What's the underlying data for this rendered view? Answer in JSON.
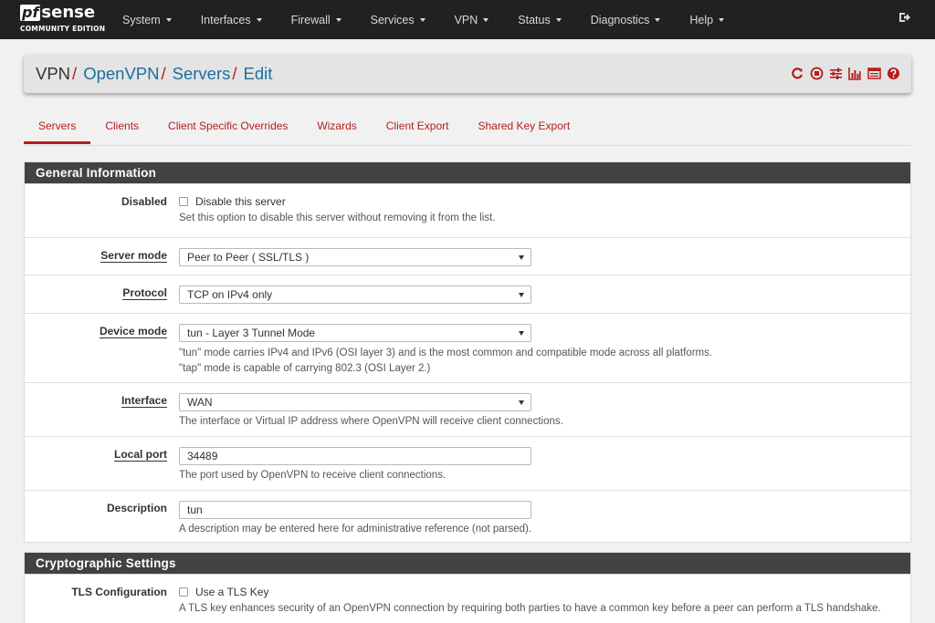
{
  "brand": {
    "logo_pf": "pf",
    "logo_sense": "sense",
    "logo_sub": "COMMUNITY EDITION"
  },
  "nav": {
    "items": [
      {
        "label": "System"
      },
      {
        "label": "Interfaces"
      },
      {
        "label": "Firewall"
      },
      {
        "label": "Services"
      },
      {
        "label": "VPN"
      },
      {
        "label": "Status"
      },
      {
        "label": "Diagnostics"
      },
      {
        "label": "Help"
      }
    ],
    "logout_icon": "logout-icon"
  },
  "breadcrumb": {
    "vpn": "VPN",
    "openvpn": "OpenVPN",
    "servers": "Servers",
    "edit": "Edit",
    "sep": "/"
  },
  "tabs": [
    {
      "label": "Servers",
      "active": true
    },
    {
      "label": "Clients"
    },
    {
      "label": "Client Specific Overrides"
    },
    {
      "label": "Wizards"
    },
    {
      "label": "Client Export"
    },
    {
      "label": "Shared Key Export"
    }
  ],
  "general": {
    "heading": "General Information",
    "disabled": {
      "label": "Disabled",
      "checkbox": "Disable this server",
      "help": "Set this option to disable this server without removing it from the list."
    },
    "server_mode": {
      "label": "Server mode",
      "value": "Peer to Peer ( SSL/TLS )"
    },
    "protocol": {
      "label": "Protocol",
      "value": "TCP on IPv4 only"
    },
    "device_mode": {
      "label": "Device mode",
      "value": "tun - Layer 3 Tunnel Mode",
      "help1": "\"tun\" mode carries IPv4 and IPv6 (OSI layer 3) and is the most common and compatible mode across all platforms.",
      "help2": "\"tap\" mode is capable of carrying 802.3 (OSI Layer 2.)"
    },
    "interface": {
      "label": "Interface",
      "value": "WAN",
      "help": "The interface or Virtual IP address where OpenVPN will receive client connections."
    },
    "local_port": {
      "label": "Local port",
      "value": "34489",
      "help": "The port used by OpenVPN to receive client connections."
    },
    "description": {
      "label": "Description",
      "value": "tun",
      "help": "A description may be entered here for administrative reference (not parsed)."
    }
  },
  "crypto": {
    "heading": "Cryptographic Settings",
    "tls": {
      "label": "TLS Configuration",
      "checkbox": "Use a TLS Key",
      "help": "A TLS key enhances security of an OpenVPN connection by requiring both parties to have a common key before a peer can perform a TLS handshake."
    }
  },
  "colors": {
    "navbar": "#212121",
    "accent": "#b71c1c",
    "link": "#1e6e9f",
    "panel_heading": "#424242"
  }
}
